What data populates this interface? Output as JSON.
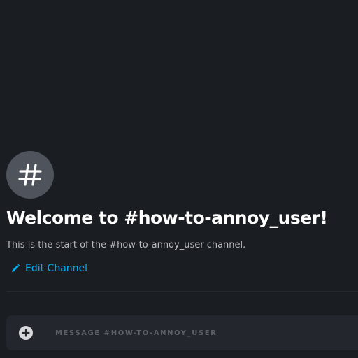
{
  "channel": {
    "icon": "hash-icon",
    "welcome_title": "Welcome to #how-to-annoy_user!",
    "welcome_subtitle": "This is the start of the #how-to-annoy_user channel.",
    "edit_label": "Edit Channel",
    "edit_icon": "pencil-icon"
  },
  "composer": {
    "add_icon": "plus-circle-icon",
    "placeholder": "MESSAGE #HOW-TO-ANNOY_USER",
    "value": ""
  },
  "colors": {
    "background": "#1a1d22",
    "avatar": "#4f545c",
    "title": "#ffffff",
    "subtitle": "#b9bbbe",
    "link": "#00aff4",
    "composer_bg": "#23262c",
    "placeholder": "#5c6067"
  }
}
